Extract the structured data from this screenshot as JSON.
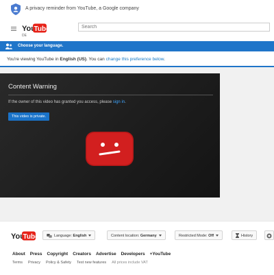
{
  "privacy": {
    "text": "A privacy reminder from YouTube, a Google company"
  },
  "masthead": {
    "logo_you": "You",
    "logo_tube": "Tube",
    "region": "DE",
    "search_placeholder": "Search"
  },
  "language_notice": {
    "title": "Choose your language.",
    "text_prefix": "You're viewing YouTube in ",
    "language": "English (US)",
    "text_middle": ". You can ",
    "link": "change this preference below",
    "text_suffix": "."
  },
  "player": {
    "title": "Content Warning",
    "message": "If the owner of this video has granted you access, please",
    "sign_in": "sign in",
    "message_end": ".",
    "private_button": "This video is private."
  },
  "footer": {
    "logo_you": "You",
    "logo_tube": "Tube",
    "language_label": "Language:",
    "language_value": "English",
    "location_label": "Content location:",
    "location_value": "Germany",
    "restricted_label": "Restricted Mode:",
    "restricted_value": "Off",
    "history": "History",
    "links_primary": [
      "About",
      "Press",
      "Copyright",
      "Creators",
      "Advertise",
      "Developers",
      "+YouTube"
    ],
    "links_secondary": [
      "Terms",
      "Privacy",
      "Policy & Safety",
      "Test new features"
    ],
    "vat_note": "All prices include VAT"
  },
  "colors": {
    "brand_red": "#e62117",
    "accent_blue": "#1f75c9",
    "link_blue": "#167ac6"
  }
}
